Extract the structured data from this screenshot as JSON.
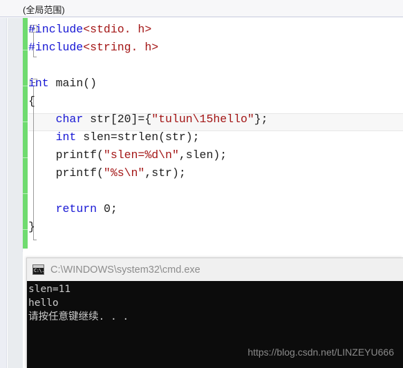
{
  "editor": {
    "scope_label": "(全局范围)",
    "language": "C",
    "change_bar_color": "#6fdb6f",
    "current_line_index": 5,
    "lines": [
      {
        "index": 0,
        "outline": "collapse",
        "tokens": [
          {
            "text": "#include",
            "cls": "pre"
          },
          {
            "text": "<stdio. h>",
            "cls": "hdr"
          }
        ]
      },
      {
        "index": 1,
        "outline": "none",
        "tokens": [
          {
            "text": "#include",
            "cls": "pre"
          },
          {
            "text": "<string. h>",
            "cls": "hdr"
          }
        ]
      },
      {
        "index": 2,
        "outline": "none",
        "tokens": []
      },
      {
        "index": 3,
        "outline": "collapse",
        "tokens": [
          {
            "text": "int",
            "cls": "kw"
          },
          {
            "text": " main()",
            "cls": "plain"
          }
        ]
      },
      {
        "index": 4,
        "outline": "none",
        "tokens": [
          {
            "text": "{",
            "cls": "plain"
          }
        ]
      },
      {
        "index": 5,
        "outline": "none",
        "tokens": [
          {
            "text": "    ",
            "cls": "plain"
          },
          {
            "text": "char",
            "cls": "kw"
          },
          {
            "text": " str[20]={",
            "cls": "plain"
          },
          {
            "text": "\"tulun\\15hello\"",
            "cls": "str"
          },
          {
            "text": "};",
            "cls": "plain"
          }
        ]
      },
      {
        "index": 6,
        "outline": "none",
        "tokens": [
          {
            "text": "    ",
            "cls": "plain"
          },
          {
            "text": "int",
            "cls": "kw"
          },
          {
            "text": " slen=strlen(str);",
            "cls": "plain"
          }
        ]
      },
      {
        "index": 7,
        "outline": "none",
        "tokens": [
          {
            "text": "    printf(",
            "cls": "plain"
          },
          {
            "text": "\"slen=%d\\n\"",
            "cls": "str"
          },
          {
            "text": ",slen);",
            "cls": "plain"
          }
        ]
      },
      {
        "index": 8,
        "outline": "none",
        "tokens": [
          {
            "text": "    printf(",
            "cls": "plain"
          },
          {
            "text": "\"%s\\n\"",
            "cls": "str"
          },
          {
            "text": ",str);",
            "cls": "plain"
          }
        ]
      },
      {
        "index": 9,
        "outline": "none",
        "tokens": []
      },
      {
        "index": 10,
        "outline": "none",
        "tokens": [
          {
            "text": "    ",
            "cls": "plain"
          },
          {
            "text": "return",
            "cls": "kw"
          },
          {
            "text": " ",
            "cls": "plain"
          },
          {
            "text": "0",
            "cls": "num"
          },
          {
            "text": ";",
            "cls": "plain"
          }
        ]
      },
      {
        "index": 11,
        "outline": "none",
        "tokens": [
          {
            "text": "}",
            "cls": "plain"
          }
        ]
      }
    ]
  },
  "console": {
    "icon": "cmd-icon",
    "icon_glyph": "C:\\.",
    "title": "C:\\WINDOWS\\system32\\cmd.exe",
    "background": "#0c0c0c",
    "foreground": "#cccccc",
    "output_lines": [
      "slen=11",
      "hello",
      "请按任意键继续. . ."
    ],
    "watermark": "https://blog.csdn.net/LINZEYU666"
  }
}
